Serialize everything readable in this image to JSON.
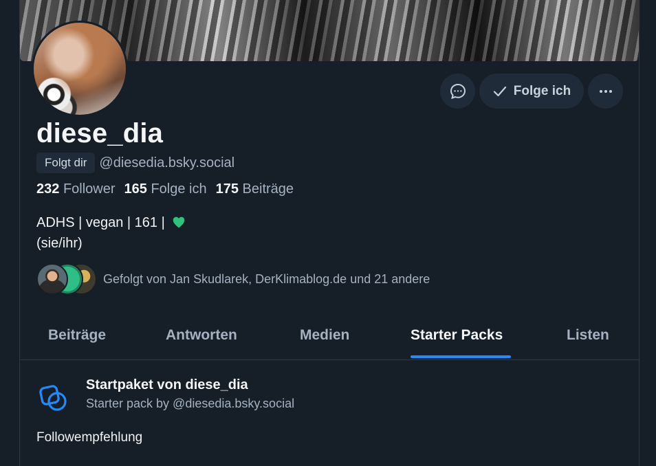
{
  "profile": {
    "display_name": "diese_dia",
    "follows_you_label": "Folgt dir",
    "handle": "@diesedia.bsky.social",
    "stats": [
      {
        "count": "232",
        "label": "Follower"
      },
      {
        "count": "165",
        "label": "Folge ich"
      },
      {
        "count": "175",
        "label": "Beiträge"
      }
    ],
    "bio_line1": "ADHS | vegan | 161 |",
    "bio_line2": "(sie/ihr)",
    "known_followers_text": "Gefolgt von Jan Skudlarek, DerKlimablog.de und 21 andere"
  },
  "actions": {
    "follow_label": "Folge ich"
  },
  "tabs": [
    {
      "label": "Beiträge",
      "active": false
    },
    {
      "label": "Antworten",
      "active": false
    },
    {
      "label": "Medien",
      "active": false
    },
    {
      "label": "Starter Packs",
      "active": true
    },
    {
      "label": "Listen",
      "active": false
    }
  ],
  "starter_pack": {
    "title": "Startpaket von diese_dia",
    "subtitle": "Starter pack by @diesedia.bsky.social",
    "description": "Followempfehlung"
  },
  "colors": {
    "background": "#161e27",
    "accent": "#208bfe",
    "button_bg": "#1f2b38",
    "muted_text": "#a4b2c1",
    "heart": "#2ec27e"
  },
  "icons": {
    "message": "message-bubble-icon",
    "check": "checkmark-icon",
    "more": "ellipsis-icon",
    "starter_pack": "starter-pack-icon",
    "heart": "green-heart-icon"
  }
}
